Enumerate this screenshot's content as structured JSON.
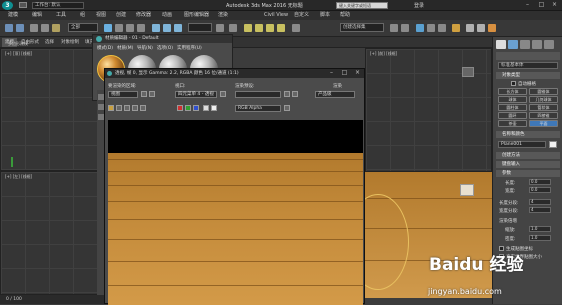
{
  "app": {
    "title": "Autodesk 3ds Max 2016",
    "file": "无标题",
    "workspace": "工作台: 默认",
    "search_placeholder": "键入关键字或短语",
    "login": "登录"
  },
  "menu": [
    "建模",
    "编辑",
    "工具",
    "组",
    "视图",
    "创建",
    "修改器",
    "动画",
    "图形编辑器",
    "渲染",
    "Civil View",
    "自定义",
    "脚本",
    "帮助"
  ],
  "toolbar": {
    "selection_filter": "全部",
    "selection_set": "创建选择集"
  },
  "ribbon": {
    "tabs": [
      "建模",
      "自由形式",
      "选择",
      "对象绘制",
      "填充"
    ],
    "sub_label": "多边形建模"
  },
  "viewports": {
    "top_left": "[+] [顶] [线框]",
    "left_mid": "[+] [左] [线框]",
    "bottom_left": "[+] [左] [线框]",
    "front": "[+] [前] [线框]"
  },
  "material_editor": {
    "title": "材质编辑器 - 01 - Default",
    "menu": [
      "模式(D)",
      "材质(M)",
      "导航(N)",
      "选项(O)",
      "实用程序(U)"
    ]
  },
  "render_window": {
    "title": "透视, 帧 0, 显示 Gamma: 2.2, RGBA 颜色 16 位/通道 (1:1)",
    "area_label": "要渲染的区域:",
    "area_value": "视图",
    "viewport_label": "视口:",
    "viewport_value": "四元菜单 4 - 透视",
    "preset_label": "渲染预设:",
    "preset_value": "",
    "render_label": "渲染",
    "render_value": "产品级",
    "channel_value": "RGB Alpha"
  },
  "command_panel": {
    "category": "标准基本体",
    "object_type_header": "对象类型",
    "autogrid_label": "自动栅格",
    "buttons": [
      "长方体",
      "圆锥体",
      "球体",
      "几何球体",
      "圆柱体",
      "管状体",
      "圆环",
      "四棱锥",
      "茶壶",
      "平面"
    ],
    "name_color_header": "名称和颜色",
    "object_name": "Plane001",
    "creation_method_header": "创建方法",
    "keyboard_entry_header": "键盘输入",
    "params_header": "参数",
    "length_label": "长度:",
    "length_value": "0.0",
    "width_label": "宽度:",
    "width_value": "0.0",
    "length_segs_label": "长度分段:",
    "length_segs_value": "4",
    "width_segs_label": "宽度分段:",
    "width_segs_value": "4",
    "render_mult_header": "渲染倍增",
    "scale_label": "缩放:",
    "scale_value": "1.0",
    "density_label": "密度:",
    "density_value": "1.0",
    "generate_uv_label": "生成贴图坐标",
    "real_world_label": "真实世界贴图大小"
  },
  "status": {
    "frame": "0 / 100"
  },
  "watermark": {
    "brand": "Baidu 经验",
    "url": "jingyan.baidu.com"
  },
  "colors": {
    "accent": "#0f8f91",
    "wood": "#c38a3a"
  }
}
